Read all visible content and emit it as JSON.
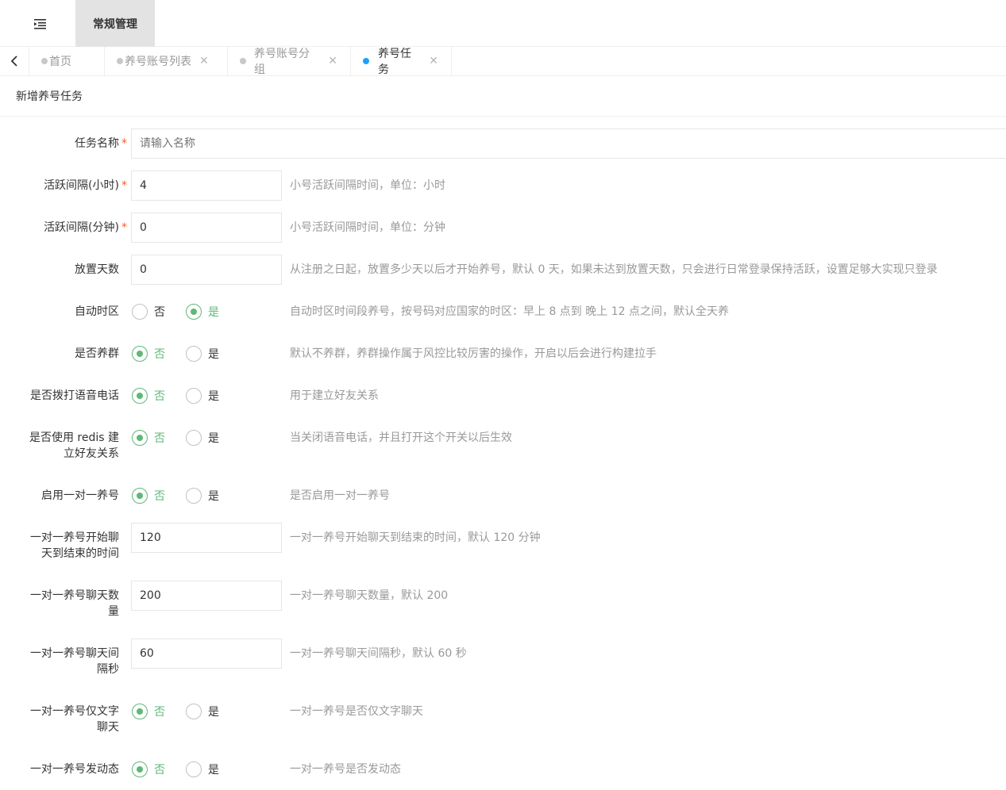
{
  "header": {
    "nav_item": "常规管理"
  },
  "tabs": [
    {
      "label": "首页",
      "closable": false,
      "active": false
    },
    {
      "label": "养号账号列表",
      "closable": true,
      "active": false
    },
    {
      "label": "养号账号分组",
      "closable": true,
      "active": false
    },
    {
      "label": "养号任务",
      "closable": true,
      "active": true
    }
  ],
  "card_title": "新增养号任务",
  "radio_labels": {
    "no": "否",
    "yes": "是"
  },
  "form": {
    "task_name": {
      "label": "任务名称",
      "placeholder": "请输入名称",
      "required": true
    },
    "active_hours": {
      "label": "活跃间隔(小时)",
      "value": "4",
      "hint": "小号活跃间隔时间，单位：小时",
      "required": true
    },
    "active_minutes": {
      "label": "活跃间隔(分钟)",
      "value": "0",
      "hint": "小号活跃间隔时间，单位：分钟",
      "required": true
    },
    "idle_days": {
      "label": "放置天数",
      "value": "0",
      "hint": "从注册之日起，放置多少天以后才开始养号，默认 0 天，如果未达到放置天数，只会进行日常登录保持活跃，设置足够大实现只登录"
    },
    "auto_timezone": {
      "label": "自动时区",
      "selected": "yes",
      "hint": "自动时区时间段养号，按号码对应国家的时区：早上 8 点到 晚上 12 点之间，默认全天养"
    },
    "raise_group": {
      "label": "是否养群",
      "selected": "no",
      "hint": "默认不养群，养群操作属于风控比较厉害的操作，开启以后会进行构建拉手"
    },
    "voice_call": {
      "label": "是否拨打语音电话",
      "selected": "no",
      "hint": "用于建立好友关系"
    },
    "use_redis": {
      "label_line1": "是否使用 redis 建",
      "label_line2": "立好友关系",
      "selected": "no",
      "hint": "当关闭语音电话，并且打开这个开关以后生效"
    },
    "one_to_one": {
      "label": "启用一对一养号",
      "selected": "no",
      "hint": "是否启用一对一养号"
    },
    "chat_duration": {
      "label_line1": "一对一养号开始聊",
      "label_line2": "天到结束的时间",
      "value": "120",
      "hint": "一对一养号开始聊天到结束的时间，默认 120 分钟"
    },
    "chat_count": {
      "label_line1": "一对一养号聊天数",
      "label_line2": "量",
      "value": "200",
      "hint": "一对一养号聊天数量，默认 200"
    },
    "chat_interval": {
      "label_line1": "一对一养号聊天间",
      "label_line2": "隔秒",
      "value": "60",
      "hint": "一对一养号聊天间隔秒，默认 60 秒"
    },
    "text_only": {
      "label_line1": "一对一养号仅文字",
      "label_line2": "聊天",
      "selected": "no",
      "hint": "一对一养号是否仅文字聊天"
    },
    "post_moments": {
      "label": "一对一养号发动态",
      "selected": "no",
      "hint": "一对一养号是否发动态"
    }
  },
  "colors": {
    "accent": "#5fb878",
    "active_tab_dot": "#1e9fff",
    "required": "#ff5722"
  }
}
